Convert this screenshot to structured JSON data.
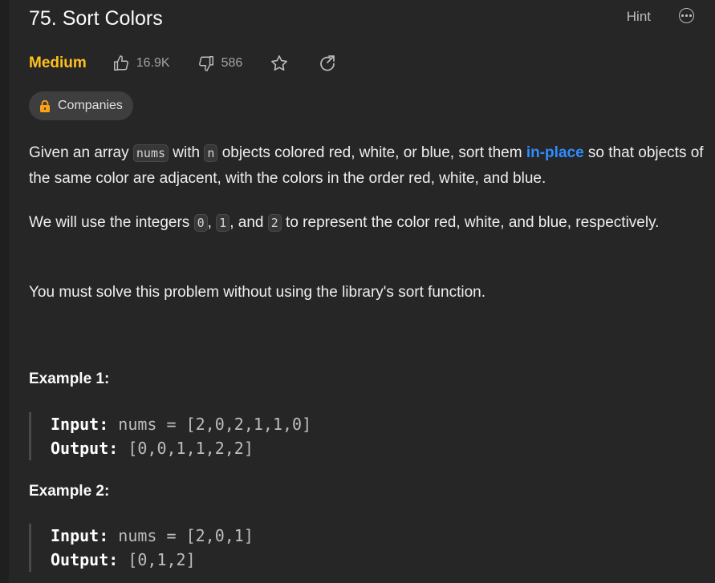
{
  "problem": {
    "title": "75. Sort Colors",
    "hint_label": "Hint",
    "difficulty": "Medium",
    "likes": "16.9K",
    "dislikes": "586",
    "companies_label": "Companies"
  },
  "description": {
    "p1": {
      "t1": "Given an array ",
      "c1": "nums",
      "t2": " with ",
      "c2": "n",
      "t3": " objects colored red, white, or blue, sort them ",
      "link": "in-place",
      "t4": " so that objects of the same color are adjacent, with the colors in the order red, white, and blue."
    },
    "p2": {
      "t1": "We will use the integers ",
      "c1": "0",
      "t2": ", ",
      "c2": "1",
      "t3": ", and ",
      "c3": "2",
      "t4": " to represent the color red, white, and blue, respectively."
    },
    "p3": "You must solve this problem without using the library's sort function."
  },
  "examples": [
    {
      "title": "Example 1:",
      "input_label": "Input:",
      "input_value": "nums = [2,0,2,1,1,0]",
      "output_label": "Output:",
      "output_value": "[0,0,1,1,2,2]"
    },
    {
      "title": "Example 2:",
      "input_label": "Input:",
      "input_value": "nums = [2,0,1]",
      "output_label": "Output:",
      "output_value": "[0,1,2]"
    }
  ],
  "icons": {
    "like": "thumbs-up-icon",
    "dislike": "thumbs-down-icon",
    "favorite": "star-icon",
    "share": "share-icon",
    "more": "more-options-icon",
    "lock": "lock-icon"
  },
  "colors": {
    "background": "#262626",
    "difficulty_medium": "#ffc01e",
    "link_blue": "#2f8cff",
    "lock_orange": "#ffa116"
  }
}
